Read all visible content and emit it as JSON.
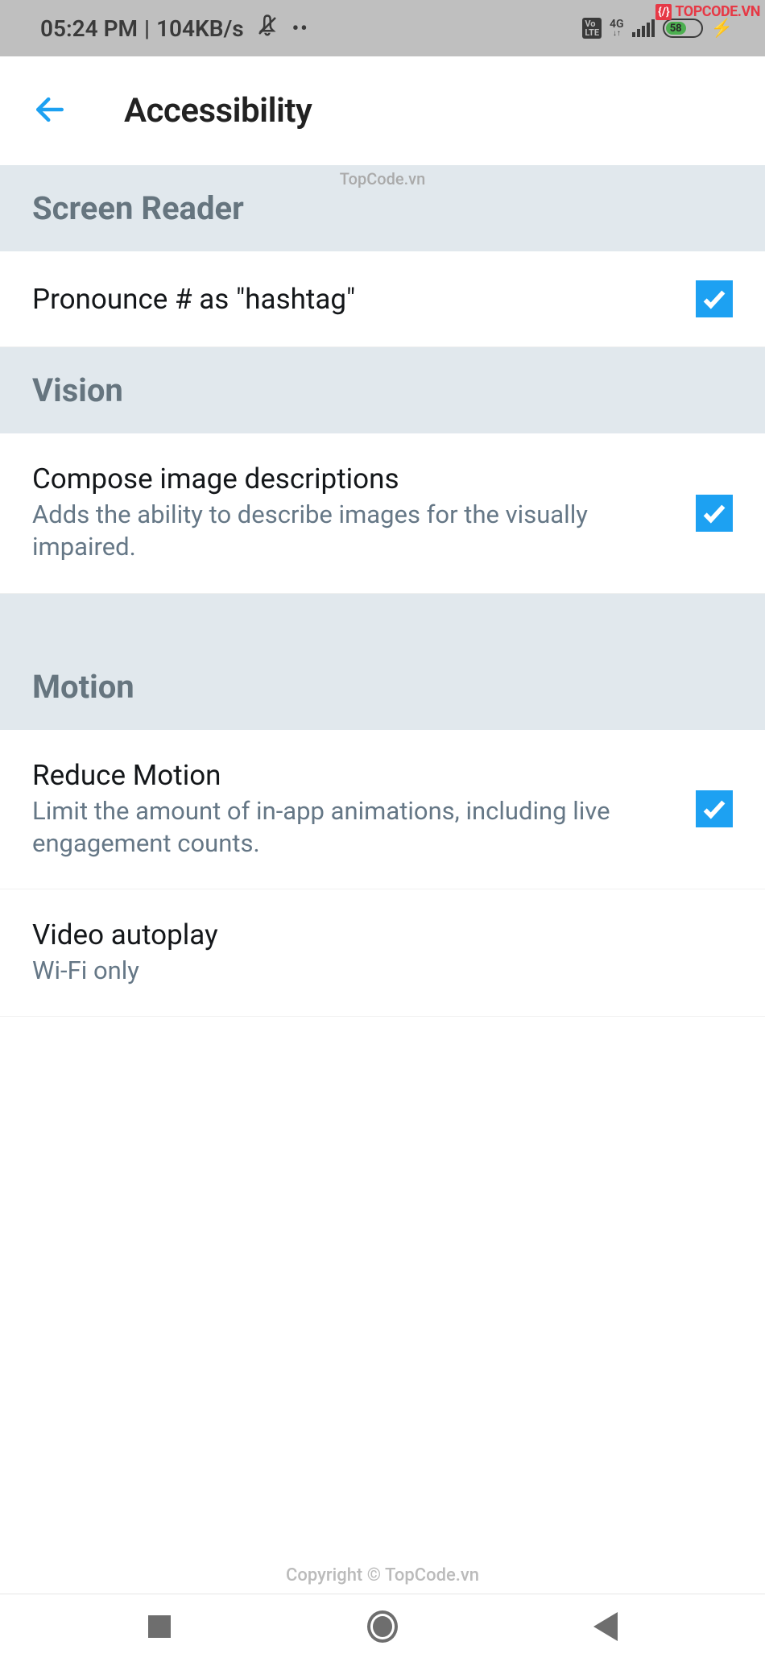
{
  "status_bar": {
    "time": "05:24 PM",
    "data_rate": "104KB/s",
    "network_label": "4G",
    "volte": "Vo LTE",
    "battery_percent": "58"
  },
  "watermark": {
    "brand": "TOPCODE.VN",
    "mid": "TopCode.vn",
    "copyright": "Copyright © TopCode.vn"
  },
  "header": {
    "title": "Accessibility"
  },
  "sections": {
    "screen_reader": {
      "title": "Screen Reader",
      "items": {
        "pronounce_hashtag": {
          "title": "Pronounce # as \"hashtag\"",
          "checked": true
        }
      }
    },
    "vision": {
      "title": "Vision",
      "items": {
        "compose_image": {
          "title": "Compose image descriptions",
          "subtitle": "Adds the ability to describe images for the visually impaired.",
          "checked": true
        }
      }
    },
    "motion": {
      "title": "Motion",
      "items": {
        "reduce_motion": {
          "title": "Reduce Motion",
          "subtitle": "Limit the amount of in-app animations, including live engagement counts.",
          "checked": true
        },
        "video_autoplay": {
          "title": "Video autoplay",
          "subtitle": "Wi-Fi only"
        }
      }
    }
  }
}
